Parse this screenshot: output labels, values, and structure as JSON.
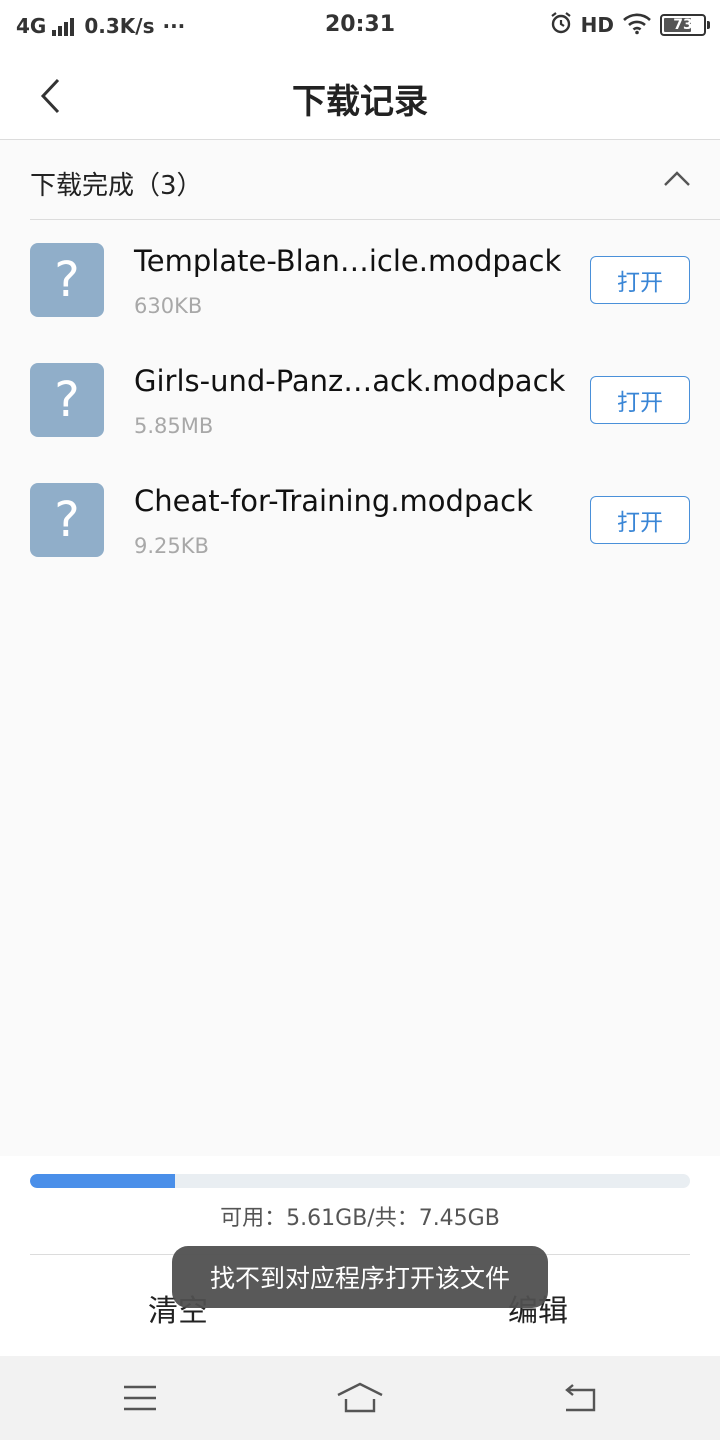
{
  "status_bar": {
    "network": "4G",
    "speed": "0.3K/s",
    "more": "···",
    "time": "20:31",
    "hd": "HD",
    "battery": "73",
    "battery_level_percent": 73
  },
  "header": {
    "title": "下载记录"
  },
  "section": {
    "label": "下载完成（3）"
  },
  "files": [
    {
      "name": "Template-Blan…icle.modpack",
      "size": "630KB",
      "icon_glyph": "?",
      "open_label": "打开"
    },
    {
      "name": "Girls-und-Panz…ack.modpack",
      "size": "5.85MB",
      "icon_glyph": "?",
      "open_label": "打开"
    },
    {
      "name": "Cheat-for-Training.modpack",
      "size": "9.25KB",
      "icon_glyph": "?",
      "open_label": "打开"
    }
  ],
  "storage": {
    "text": "可用：5.61GB/共：7.45GB",
    "used_fraction": 0.22
  },
  "actions": {
    "clear": "清空",
    "edit": "编辑"
  },
  "toast": {
    "message": "找不到对应程序打开该文件"
  },
  "colors": {
    "accent": "#4a8fe9",
    "file_icon_bg": "#90aec9",
    "open_button": "#3a86d6"
  },
  "icons": {
    "back": "chevron-left-icon",
    "collapse": "chevron-up-icon",
    "file": "unknown-file-icon",
    "sys_menu": "menu-icon",
    "sys_home": "home-icon",
    "sys_back": "back-arrow-icon"
  }
}
